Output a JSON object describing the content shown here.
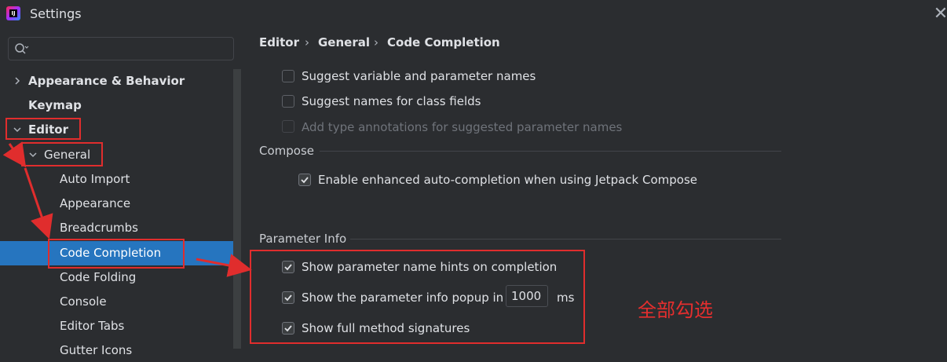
{
  "window": {
    "title": "Settings",
    "close_icon": "close-icon"
  },
  "sidebar": {
    "search": {
      "value": "",
      "placeholder": ""
    },
    "items": [
      {
        "label": "Appearance & Behavior"
      },
      {
        "label": "Keymap"
      },
      {
        "label": "Editor"
      },
      {
        "label": "General"
      },
      {
        "label": "Auto Import"
      },
      {
        "label": "Appearance"
      },
      {
        "label": "Breadcrumbs"
      },
      {
        "label": "Code Completion"
      },
      {
        "label": "Code Folding"
      },
      {
        "label": "Console"
      },
      {
        "label": "Editor Tabs"
      },
      {
        "label": "Gutter Icons"
      }
    ],
    "selected_color": "#2675bf"
  },
  "breadcrumb": {
    "items": [
      "Editor",
      "General",
      "Code Completion"
    ],
    "separator": "›"
  },
  "options_top": [
    {
      "label": "Suggest variable and parameter names",
      "checked": false,
      "enabled": true
    },
    {
      "label": "Suggest names for class fields",
      "checked": false,
      "enabled": true
    },
    {
      "label": "Add type annotations for suggested parameter names",
      "checked": false,
      "enabled": false
    }
  ],
  "compose": {
    "title": "Compose",
    "options": [
      {
        "label": "Enable enhanced auto-completion when using Jetpack Compose",
        "checked": true
      }
    ]
  },
  "parameter_info": {
    "title": "Parameter Info",
    "options": [
      {
        "label": "Show parameter name hints on completion",
        "checked": true
      },
      {
        "label": "Show the parameter info popup in",
        "checked": true,
        "value": "1000",
        "unit": "ms"
      },
      {
        "label": "Show full method signatures",
        "checked": true
      }
    ]
  },
  "annotation": {
    "text": "全部勾选",
    "color": "#e02d2d"
  }
}
